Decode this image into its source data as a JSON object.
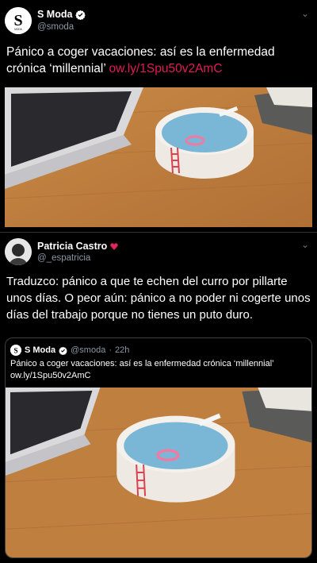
{
  "tweet1": {
    "name": "S Moda",
    "handle": "@smoda",
    "text": "Pánico a coger vacaciones: así es la enfermedad crónica ‘millennial’",
    "link": "ow.ly/1Spu50v2AmC",
    "image_alt": "laptop and tray shaped like a round swimming pool on wooden desk"
  },
  "tweet2": {
    "name": "Patricia Castro",
    "handle": "@_espatricia",
    "text": "Traduzco: pánico a que te echen del curro por pillarte unos días. O peor aún: pánico a no poder ni cogerte unos días del trabajo porque no tienes un puto duro.",
    "quote": {
      "name": "S Moda",
      "handle": "@smoda",
      "sep": "·",
      "time": "22h",
      "text": "Pánico a coger vacaciones: así es la enfermedad crónica ‘millennial’",
      "link": "ow.ly/1Spu50v2AmC"
    }
  },
  "colors": {
    "background": "#000000",
    "link": "#e2195b",
    "verified": "#ffffff",
    "heart": "#e0245e"
  },
  "icons": [
    "verified-icon",
    "chevron-down-icon",
    "heart-icon"
  ]
}
